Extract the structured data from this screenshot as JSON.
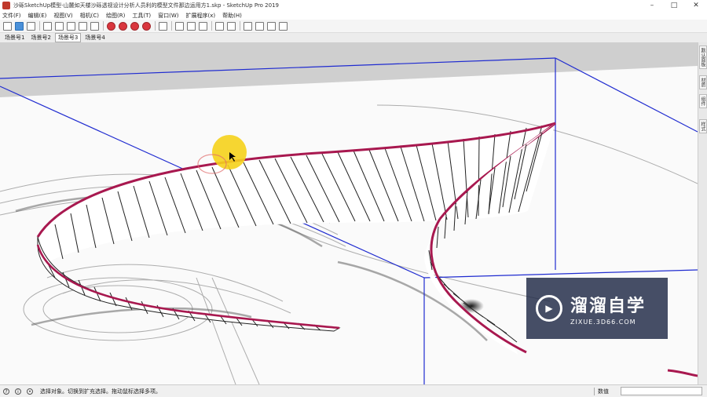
{
  "window": {
    "title": "沙砾SketchUp模型-山麓如天楼沙砾透视设计分析人员利的模型文件那边运用方1.skp - SketchUp Pro 2019",
    "min_glyph": "–",
    "max_glyph": "□",
    "close_glyph": "✕"
  },
  "menu": {
    "items": [
      "文件(F)",
      "编辑(E)",
      "视图(V)",
      "相机(C)",
      "绘图(R)",
      "工具(T)",
      "窗口(W)",
      "扩展程序(x)",
      "帮助(H)"
    ]
  },
  "scenes": {
    "tabs": [
      "场景号1",
      "场景号2",
      "场景号3",
      "场景号4"
    ],
    "current_index": 2
  },
  "right_panel": {
    "tabs": [
      "默认面板",
      "材质",
      "组件",
      "样式"
    ]
  },
  "status": {
    "info_glyph": "?",
    "help_glyph": "i",
    "person_glyph": "•",
    "message": "选择对象。切换到扩充选择。拖动鼠标选择多项。",
    "measure_label": "数值",
    "measure_value": ""
  },
  "watermark": {
    "title": "溜溜自学",
    "subtitle": "ZIXUE.3D66.COM",
    "logo_glyph": "▶"
  },
  "colors": {
    "axis_blue": "#1f2bd0",
    "ribbon_edge": "#a8184f",
    "cursor_highlight": "#f5d21b"
  }
}
